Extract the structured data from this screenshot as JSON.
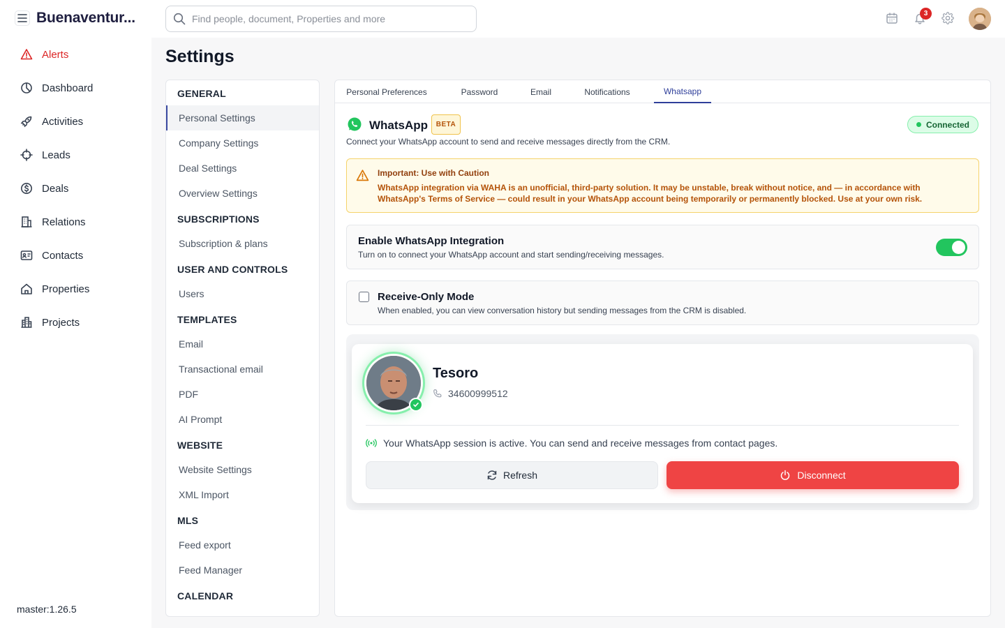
{
  "app": {
    "brand": "Buenaventur...",
    "version": "master:1.26.5"
  },
  "search": {
    "placeholder": "Find people, document, Properties and more"
  },
  "header": {
    "notification_count": "3",
    "icons": [
      "calendar-icon",
      "bell-icon",
      "gear-icon"
    ]
  },
  "sidebar": {
    "items": [
      {
        "label": "Alerts",
        "icon": "alert-triangle-icon"
      },
      {
        "label": "Dashboard",
        "icon": "pie-chart-icon"
      },
      {
        "label": "Activities",
        "icon": "rocket-icon"
      },
      {
        "label": "Leads",
        "icon": "crosshair-icon"
      },
      {
        "label": "Deals",
        "icon": "dollar-icon"
      },
      {
        "label": "Relations",
        "icon": "building-icon"
      },
      {
        "label": "Contacts",
        "icon": "id-card-icon"
      },
      {
        "label": "Properties",
        "icon": "home-icon"
      },
      {
        "label": "Projects",
        "icon": "city-icon"
      }
    ]
  },
  "page": {
    "title": "Settings"
  },
  "settings_menu": {
    "sections": [
      {
        "heading": "GENERAL",
        "links": [
          "Personal Settings",
          "Company Settings",
          "Deal Settings",
          "Overview Settings"
        ]
      },
      {
        "heading": "SUBSCRIPTIONS",
        "links": [
          "Subscription & plans"
        ]
      },
      {
        "heading": "USER AND CONTROLS",
        "links": [
          "Users"
        ]
      },
      {
        "heading": "TEMPLATES",
        "links": [
          "Email",
          "Transactional email",
          "PDF",
          "AI Prompt"
        ]
      },
      {
        "heading": "WEBSITE",
        "links": [
          "Website Settings",
          "XML Import"
        ]
      },
      {
        "heading": "MLS",
        "links": [
          "Feed export",
          "Feed Manager"
        ]
      },
      {
        "heading": "CALENDAR",
        "links": []
      }
    ]
  },
  "tabs": [
    "Personal Preferences",
    "Password",
    "Email",
    "Notifications",
    "Whatsapp"
  ],
  "whatsapp": {
    "title": "WhatsApp",
    "beta": "BETA",
    "status": "Connected",
    "description": "Connect your WhatsApp account to send and receive messages directly from the CRM.",
    "warning": {
      "title": "Important: Use with Caution",
      "body": "WhatsApp integration via WAHA is an unofficial, third-party solution. It may be unstable, break without notice, and — in accordance with WhatsApp's Terms of Service — could result in your WhatsApp account being temporarily or permanently blocked. Use at your own risk."
    },
    "enable": {
      "title": "Enable WhatsApp Integration",
      "description": "Turn on to connect your WhatsApp account and start sending/receiving messages."
    },
    "receive_only": {
      "title": "Receive-Only Mode",
      "description": "When enabled, you can view conversation history but sending messages from the CRM is disabled."
    },
    "session": {
      "name": "Tesoro",
      "phone": "34600999512",
      "message": "Your WhatsApp session is active. You can send and receive messages from contact pages.",
      "refresh_label": "Refresh",
      "disconnect_label": "Disconnect"
    }
  },
  "colors": {
    "accent": "#2f3f9a",
    "alert": "#dc2626",
    "whatsapp_green": "#22c55e",
    "danger": "#ef4444"
  }
}
